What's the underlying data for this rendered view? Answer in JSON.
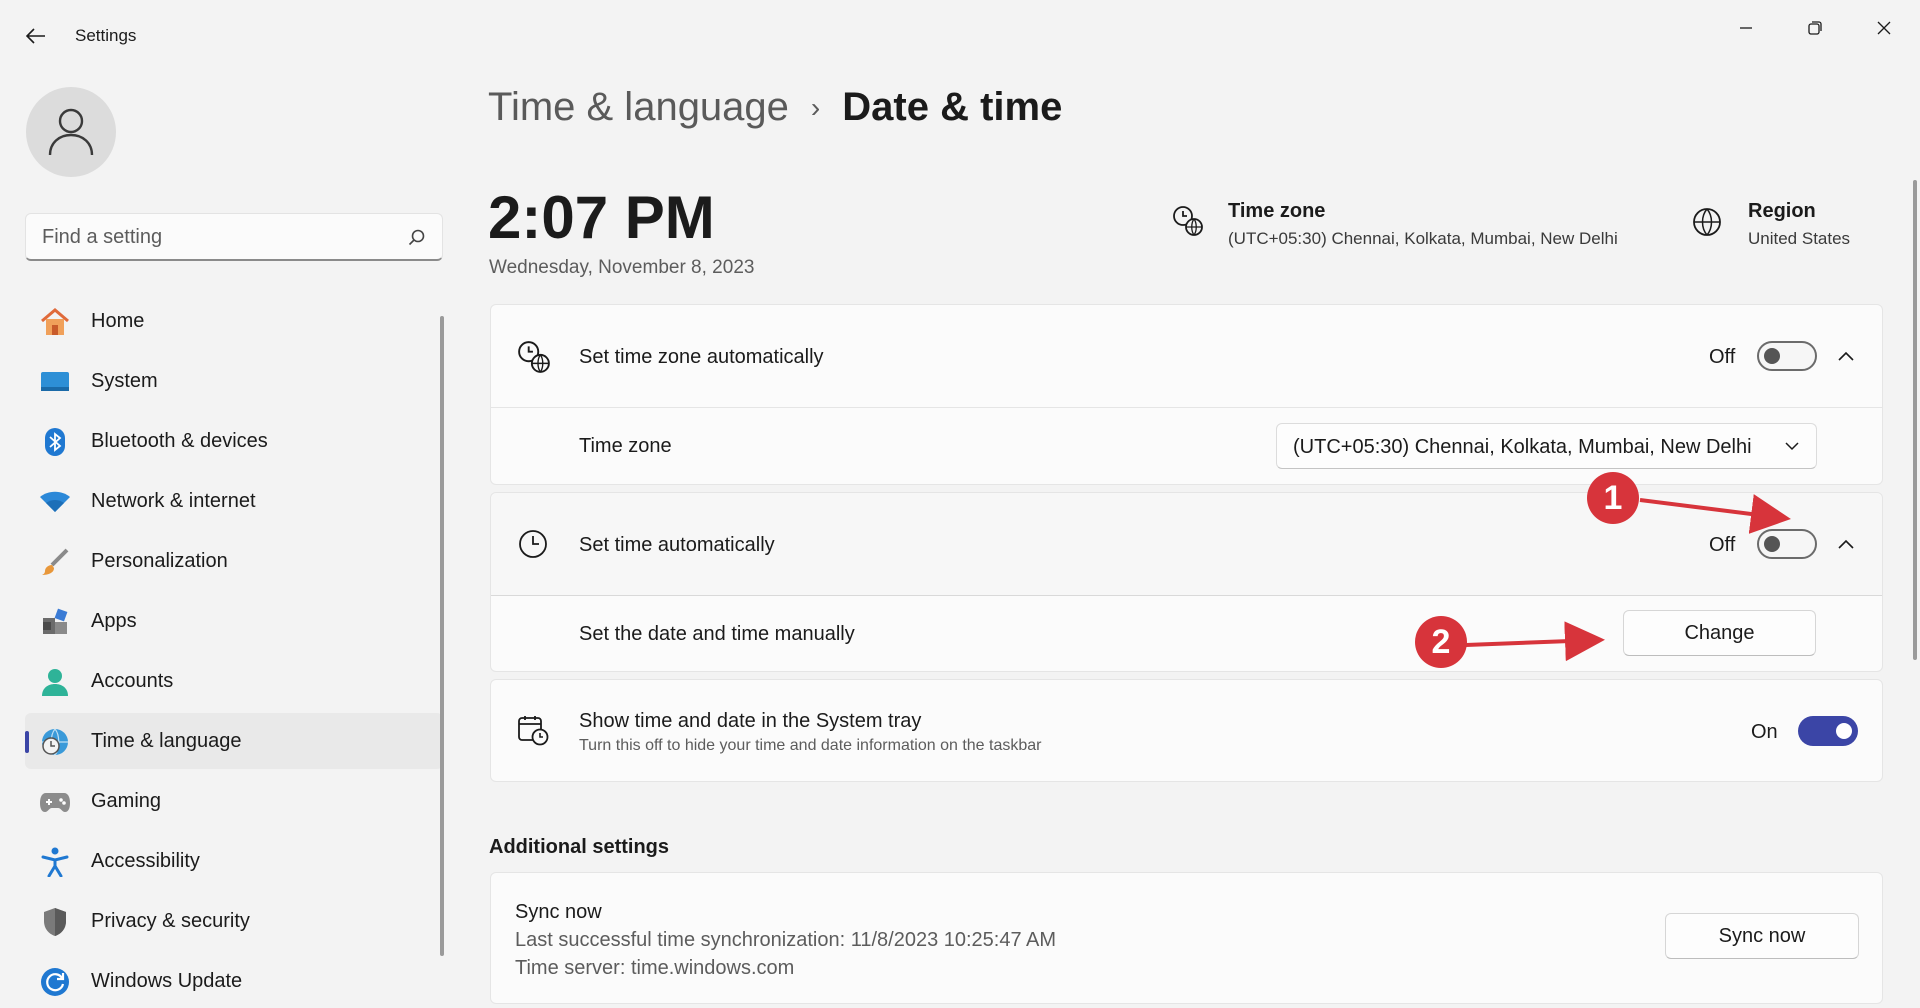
{
  "window": {
    "title": "Settings"
  },
  "search": {
    "placeholder": "Find a setting"
  },
  "sidebar": {
    "items": [
      {
        "label": "Home",
        "icon": "home-icon"
      },
      {
        "label": "System",
        "icon": "system-icon"
      },
      {
        "label": "Bluetooth & devices",
        "icon": "bluetooth-icon"
      },
      {
        "label": "Network & internet",
        "icon": "wifi-icon"
      },
      {
        "label": "Personalization",
        "icon": "brush-icon"
      },
      {
        "label": "Apps",
        "icon": "apps-icon"
      },
      {
        "label": "Accounts",
        "icon": "accounts-icon"
      },
      {
        "label": "Time & language",
        "icon": "time-language-icon",
        "active": true
      },
      {
        "label": "Gaming",
        "icon": "gamepad-icon"
      },
      {
        "label": "Accessibility",
        "icon": "accessibility-icon"
      },
      {
        "label": "Privacy & security",
        "icon": "shield-icon"
      },
      {
        "label": "Windows Update",
        "icon": "update-icon"
      }
    ]
  },
  "breadcrumb": {
    "parent": "Time & language",
    "separator": "›",
    "current": "Date & time"
  },
  "clock": {
    "time": "2:07 PM",
    "date": "Wednesday, November 8, 2023"
  },
  "info": {
    "timezone_title": "Time zone",
    "timezone_value": "(UTC+05:30) Chennai, Kolkata, Mumbai, New Delhi",
    "region_title": "Region",
    "region_value": "United States"
  },
  "settings": {
    "tz_auto": {
      "label": "Set time zone automatically",
      "state": "Off"
    },
    "tz_select": {
      "label": "Time zone",
      "value": "(UTC+05:30) Chennai, Kolkata, Mumbai, New Delhi"
    },
    "time_auto": {
      "label": "Set time automatically",
      "state": "Off"
    },
    "manual": {
      "label": "Set the date and time manually",
      "button": "Change"
    },
    "tray": {
      "label": "Show time and date in the System tray",
      "sublabel": "Turn this off to hide your time and date information on the taskbar",
      "state": "On"
    }
  },
  "additional": {
    "title": "Additional settings",
    "sync_title": "Sync now",
    "sync_last": "Last successful time synchronization: 11/8/2023 10:25:47 AM",
    "sync_server": "Time server: time.windows.com",
    "sync_button": "Sync now"
  },
  "annotations": {
    "badge1": "1",
    "badge2": "2"
  },
  "colors": {
    "accent": "#3b45a6",
    "annotation": "#d7343b"
  }
}
